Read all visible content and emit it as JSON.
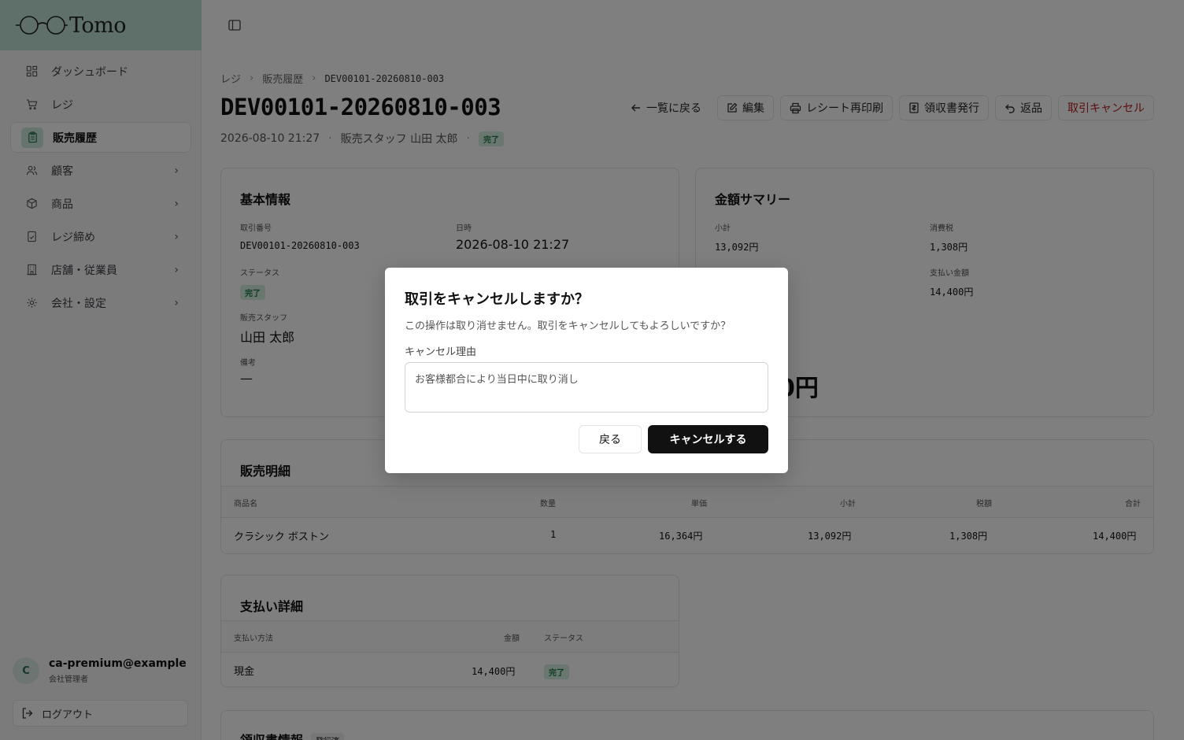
{
  "app": {
    "name": "Tomo"
  },
  "sidebar": {
    "items": [
      {
        "label": "ダッシュボード",
        "icon": "dashboard-icon",
        "chevron": false,
        "active": false
      },
      {
        "label": "レジ",
        "icon": "cart-icon",
        "chevron": false,
        "active": false
      },
      {
        "label": "販売履歴",
        "icon": "clipboard-icon",
        "chevron": false,
        "active": true
      },
      {
        "label": "顧客",
        "icon": "users-icon",
        "chevron": true,
        "active": false
      },
      {
        "label": "商品",
        "icon": "package-icon",
        "chevron": true,
        "active": false
      },
      {
        "label": "レジ締め",
        "icon": "receipt-icon",
        "chevron": true,
        "active": false
      },
      {
        "label": "店舗・従業員",
        "icon": "building-icon",
        "chevron": true,
        "active": false
      },
      {
        "label": "会社・設定",
        "icon": "gear-icon",
        "chevron": true,
        "active": false
      }
    ],
    "user": {
      "initial": "C",
      "email": "ca-premium@example....",
      "role": "会社管理者"
    },
    "logout_label": "ログアウト"
  },
  "breadcrumb": {
    "root": "レジ",
    "parent": "販売履歴",
    "current": "DEV00101-20260810-003"
  },
  "header": {
    "title": "DEV00101-20260810-003",
    "datetime": "2026-08-10 21:27",
    "staff": "販売スタッフ 山田 太郎",
    "status": "完了"
  },
  "actions": {
    "back": "一覧に戻る",
    "edit": "編集",
    "reprint": "レシート再印刷",
    "receipt": "領収書発行",
    "return": "返品",
    "cancel": "取引キャンセル"
  },
  "basic_info": {
    "title": "基本情報",
    "txn_label": "取引番号",
    "txn_value": "DEV00101-20260810-003",
    "date_label": "日時",
    "date_value": "2026-08-10 21:27",
    "status_label": "ステータス",
    "status_value": "完了",
    "staff_label": "販売スタッフ",
    "staff_value": "山田 太郎",
    "note_label": "備考",
    "note_value": "—"
  },
  "summary": {
    "title": "金額サマリー",
    "subtotal_label": "小計",
    "subtotal_value": "13,092円",
    "tax_label": "消費税",
    "tax_value": "1,308円",
    "paid_label": "支払い金額",
    "paid_value": "14,400円",
    "total_partial": "0円"
  },
  "sales_detail": {
    "title": "販売明細",
    "columns": [
      "商品名",
      "数量",
      "単価",
      "小計",
      "税額",
      "合計"
    ],
    "rows": [
      [
        "クラシック ボストン",
        "1",
        "16,364円",
        "13,092円",
        "1,308円",
        "14,400円"
      ]
    ]
  },
  "payment_detail": {
    "title": "支払い詳細",
    "columns": [
      "支払い方法",
      "金額",
      "ステータス"
    ],
    "rows": [
      [
        "現金",
        "14,400円",
        "完了"
      ]
    ]
  },
  "receipt_info": {
    "title": "領収書情報",
    "badge": "発行済"
  },
  "dialog": {
    "title": "取引をキャンセルしますか？",
    "description": "この操作は取り消せません。取引をキャンセルしてもよろしいですか？",
    "reason_label": "キャンセル理由",
    "reason_value": "お客様都合により当日中に取り消し",
    "back_label": "戻る",
    "confirm_label": "キャンセルする"
  },
  "colors": {
    "accent": "#bfe0d6",
    "danger": "#b91c1c",
    "success_badge": "#d5efe0",
    "primary": "#111111"
  }
}
